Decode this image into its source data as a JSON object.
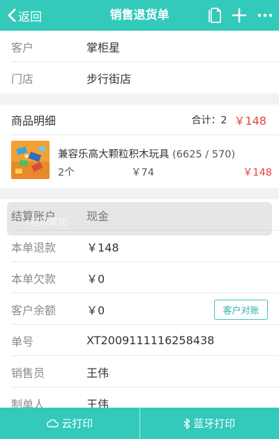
{
  "header": {
    "back_label": "返回",
    "title": "销售退货单"
  },
  "info": {
    "customer_label": "客户",
    "customer_value": "掌柜星",
    "store_label": "门店",
    "store_value": "步行街店"
  },
  "goods": {
    "section_title": "商品明细",
    "summary_label": "合计：",
    "summary_count": "2",
    "summary_amount": "￥148",
    "item": {
      "name": "兼容乐高大颗粒积木玩具",
      "codes": "(6625 / 570)",
      "qty": "2个",
      "unit_price": "￥74",
      "total": "￥148"
    }
  },
  "details": {
    "account_label": "结算账户",
    "account_value": "现金",
    "refund_label": "本单退款",
    "refund_value": "￥148",
    "debt_label": "本单欠款",
    "debt_value": "￥0",
    "balance_label": "客户余额",
    "balance_value": "￥0",
    "reconcile_button": "客户对账",
    "order_no_label": "单号",
    "order_no_value": "XT2009111116258438",
    "salesperson_label": "销售员",
    "salesperson_value": "王伟",
    "creator_label": "制单人",
    "creator_value": "王伟"
  },
  "toast": {
    "text": "打印成功"
  },
  "footer": {
    "cloud_print": "云打印",
    "bluetooth_print": "蓝牙打印"
  },
  "colors": {
    "primary": "#33c9bb",
    "accent_red": "#e8423c"
  }
}
